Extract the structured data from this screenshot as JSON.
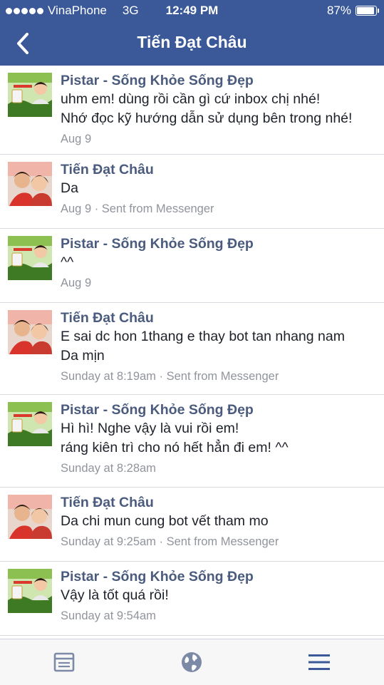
{
  "status_bar": {
    "carrier": "VinaPhone",
    "network": "3G",
    "time": "12:49 PM",
    "battery": "87%"
  },
  "header": {
    "title": "Tiến Đạt Châu",
    "back_icon": "chevron-left-icon"
  },
  "messages": [
    {
      "sender": "Pistar - Sống Khỏe Sống Đẹp",
      "lines": [
        "uhm em! dùng rồi cần gì cứ inbox chị nhé!",
        "Nhớ đọc kỹ hướng dẫn sử dụng bên trong nhé!"
      ],
      "meta": "Aug 9",
      "avatar": "page-logo"
    },
    {
      "sender": "Tiến Đạt Châu",
      "lines": [
        "Da"
      ],
      "meta": "Aug 9 · Sent from Messenger",
      "avatar": "user-photo"
    },
    {
      "sender": "Pistar - Sống Khỏe Sống Đẹp",
      "lines": [
        "^^"
      ],
      "meta": "Aug 9",
      "avatar": "page-logo"
    },
    {
      "sender": "Tiến Đạt Châu",
      "lines": [
        "E sai dc hon 1thang e thay bot tan nhang nam",
        "Da mịn"
      ],
      "meta": "Sunday at 8:19am · Sent from Messenger",
      "avatar": "user-photo"
    },
    {
      "sender": "Pistar - Sống Khỏe Sống Đẹp",
      "lines": [
        "Hì hì! Nghe vậy là vui rồi em!",
        "ráng kiên trì cho nó hết hẳn đi em! ^^"
      ],
      "meta": "Sunday at 8:28am",
      "avatar": "page-logo"
    },
    {
      "sender": "Tiến Đạt Châu",
      "lines": [
        "Da chi mun cung bot vết tham mo"
      ],
      "meta": "Sunday at 9:25am · Sent from Messenger",
      "avatar": "user-photo"
    },
    {
      "sender": "Pistar - Sống Khỏe Sống Đẹp",
      "lines": [
        "Vậy là tốt quá rồi!"
      ],
      "meta": "Sunday at 9:54am",
      "avatar": "page-logo"
    }
  ],
  "tab_bar": {
    "items": [
      "news-feed-icon",
      "globe-icon",
      "menu-icon"
    ],
    "active_color": "#3b5998",
    "inactive_color": "#8d949e"
  },
  "colors": {
    "header_bg": "#3b5998",
    "sender": "#4b5b7e",
    "meta": "#90949c"
  }
}
